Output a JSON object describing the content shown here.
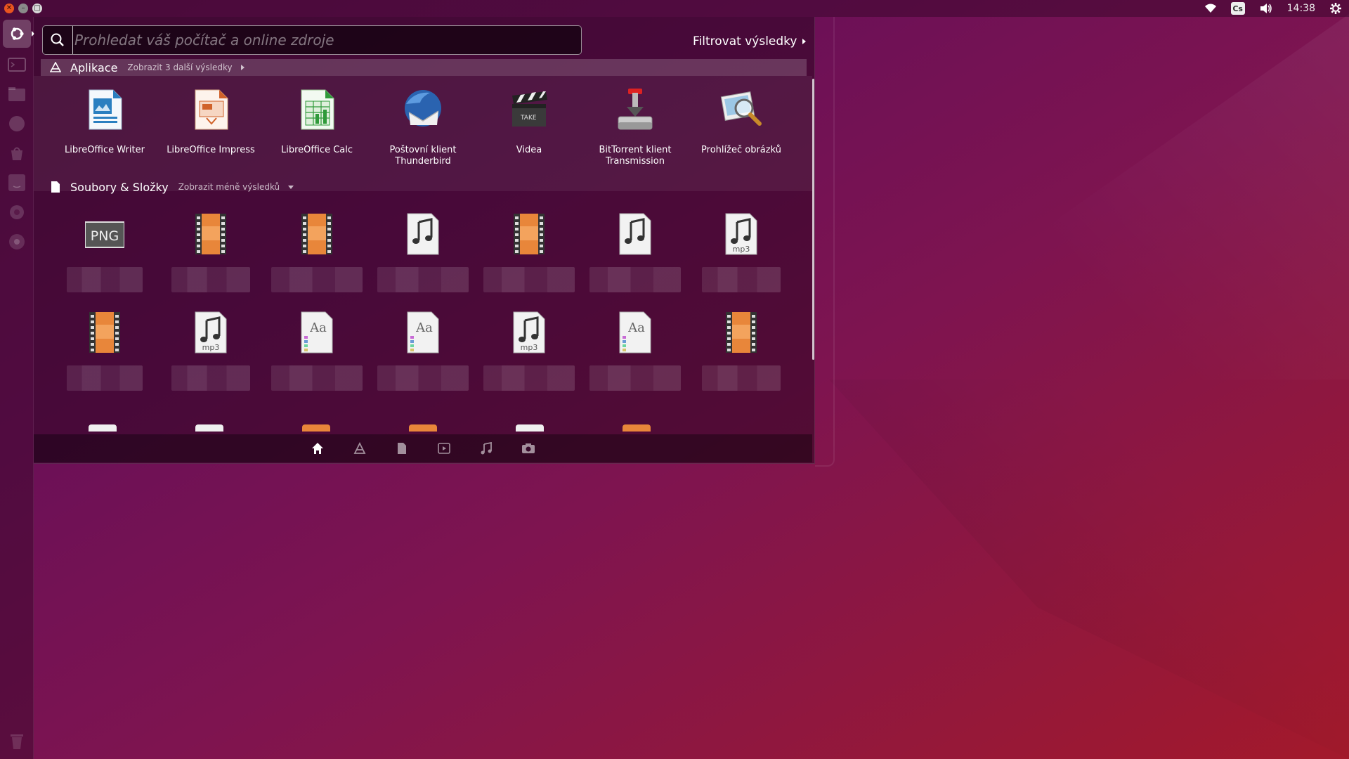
{
  "desktop": {
    "colors": {
      "accent": "#e95420",
      "dash_bg": "#3a0a2e"
    }
  },
  "top_panel": {
    "clock": "14:38",
    "keyboard_layout": "Cs",
    "icons": [
      "wifi-icon",
      "volume-icon",
      "power-settings-icon"
    ]
  },
  "launcher": {
    "items": [
      "dash-home",
      "terminal",
      "files",
      "firefox",
      "software-center",
      "amazon",
      "system-settings",
      "settings-circle",
      "trash"
    ]
  },
  "search": {
    "placeholder": "Prohledat váš počítač a online zdroje",
    "value": ""
  },
  "filter": {
    "label": "Filtrovat výsledky"
  },
  "apps_category": {
    "title": "Aplikace",
    "more": "Zobrazit 3 další výsledky",
    "items": [
      {
        "label": "LibreOffice Writer",
        "icon": "libreoffice-writer-icon"
      },
      {
        "label": "LibreOffice Impress",
        "icon": "libreoffice-impress-icon"
      },
      {
        "label": "LibreOffice Calc",
        "icon": "libreoffice-calc-icon"
      },
      {
        "label": "Poštovní klient Thunderbird",
        "icon": "thunderbird-icon"
      },
      {
        "label": "Videa",
        "icon": "videos-icon"
      },
      {
        "label": "BitTorrent klient Transmission",
        "icon": "transmission-icon"
      },
      {
        "label": "Prohlížeč obrázků",
        "icon": "image-viewer-icon"
      }
    ]
  },
  "files_category": {
    "title": "Soubory & Složky",
    "less": "Zobrazit méně výsledků",
    "row1": [
      {
        "type": "png",
        "icon": "png-file-icon",
        "badge": "PNG"
      },
      {
        "type": "video",
        "icon": "video-file-icon"
      },
      {
        "type": "video",
        "icon": "video-file-icon"
      },
      {
        "type": "audio",
        "icon": "audio-file-icon"
      },
      {
        "type": "video",
        "icon": "video-file-icon"
      },
      {
        "type": "audio",
        "icon": "audio-file-icon"
      },
      {
        "type": "mp3",
        "icon": "mp3-file-icon",
        "badge": "mp3"
      }
    ],
    "row2": [
      {
        "type": "video",
        "icon": "video-file-icon"
      },
      {
        "type": "mp3",
        "icon": "mp3-file-icon",
        "badge": "mp3"
      },
      {
        "type": "font",
        "icon": "font-file-icon",
        "badge": "Aa"
      },
      {
        "type": "font",
        "icon": "font-file-icon",
        "badge": "Aa"
      },
      {
        "type": "mp3",
        "icon": "mp3-file-icon",
        "badge": "mp3"
      },
      {
        "type": "font",
        "icon": "font-file-icon",
        "badge": "Aa"
      },
      {
        "type": "video",
        "icon": "video-file-icon"
      }
    ]
  },
  "lens_bar": {
    "items": [
      "home-lens-icon",
      "applications-lens-icon",
      "files-lens-icon",
      "video-lens-icon",
      "music-lens-icon",
      "photo-lens-icon"
    ],
    "active": "home-lens-icon"
  }
}
